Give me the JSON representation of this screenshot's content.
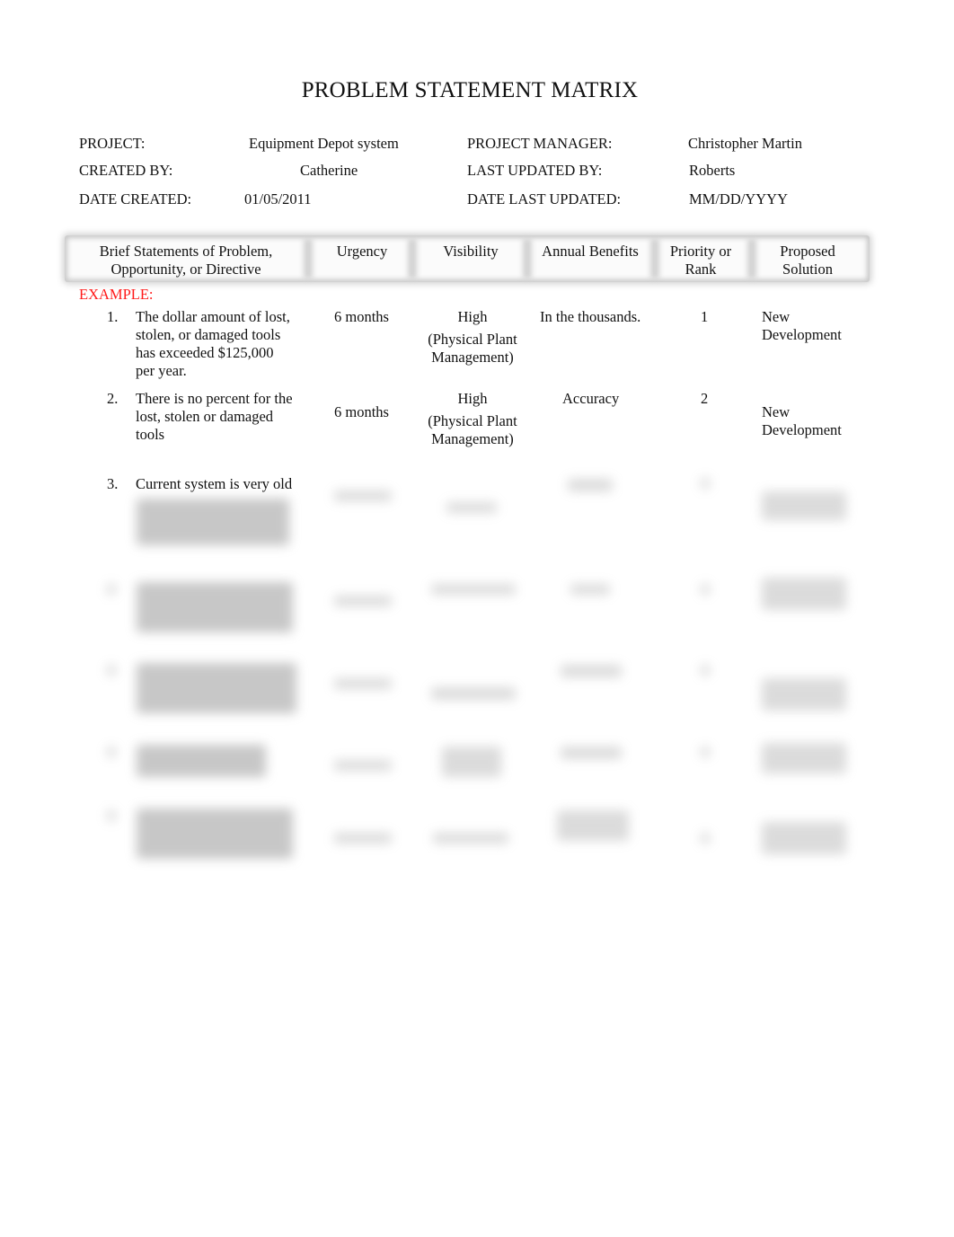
{
  "document": {
    "title": "PROBLEM STATEMENT MATRIX",
    "meta": {
      "project_label": "PROJECT:",
      "project_value": "Equipment Depot system",
      "project_manager_label": "PROJECT MANAGER:",
      "project_manager_value": "Christopher Martin",
      "created_by_label": "CREATED BY:",
      "created_by_value": "Catherine",
      "last_updated_by_label": "LAST UPDATED BY:",
      "last_updated_by_value": "Roberts",
      "date_created_label": "DATE CREATED:",
      "date_created_value": "01/05/2011",
      "date_last_updated_label": "DATE LAST UPDATED:",
      "date_last_updated_value": "MM/DD/YYYY"
    },
    "table": {
      "headers": [
        {
          "line1": "Brief Statements of Problem,",
          "line2": "Opportunity, or Directive"
        },
        {
          "line1": "Urgency",
          "line2": ""
        },
        {
          "line1": "Visibility",
          "line2": ""
        },
        {
          "line1": "Annual Benefits",
          "line2": ""
        },
        {
          "line1": "Priority or",
          "line2": "Rank"
        },
        {
          "line1": "Proposed",
          "line2": "Solution"
        }
      ],
      "example_label": "EXAMPLE:",
      "rows": [
        {
          "number": "1.",
          "statement": [
            "The dollar amount of lost,",
            "stolen, or damaged tools",
            "has exceeded $125,000",
            "per year."
          ],
          "urgency": "6 months",
          "visibility": [
            "High",
            "(Physical Plant",
            "Management)"
          ],
          "annual_benefits": "In the thousands.",
          "priority": "1",
          "solution": [
            "New",
            "Development"
          ]
        },
        {
          "number": "2.",
          "statement": [
            "There is no percent for the",
            "lost, stolen or damaged",
            "tools"
          ],
          "urgency": "6 months",
          "visibility": [
            "High",
            "(Physical Plant",
            "Management)"
          ],
          "annual_benefits": "Accuracy",
          "priority": "2",
          "solution": [
            "New",
            "Development"
          ]
        },
        {
          "number": "3.",
          "statement": [
            "Current system is very old"
          ],
          "urgency": "",
          "visibility": [],
          "annual_benefits": "",
          "priority": "",
          "solution": []
        }
      ],
      "blurred_rows_count": 4
    }
  }
}
